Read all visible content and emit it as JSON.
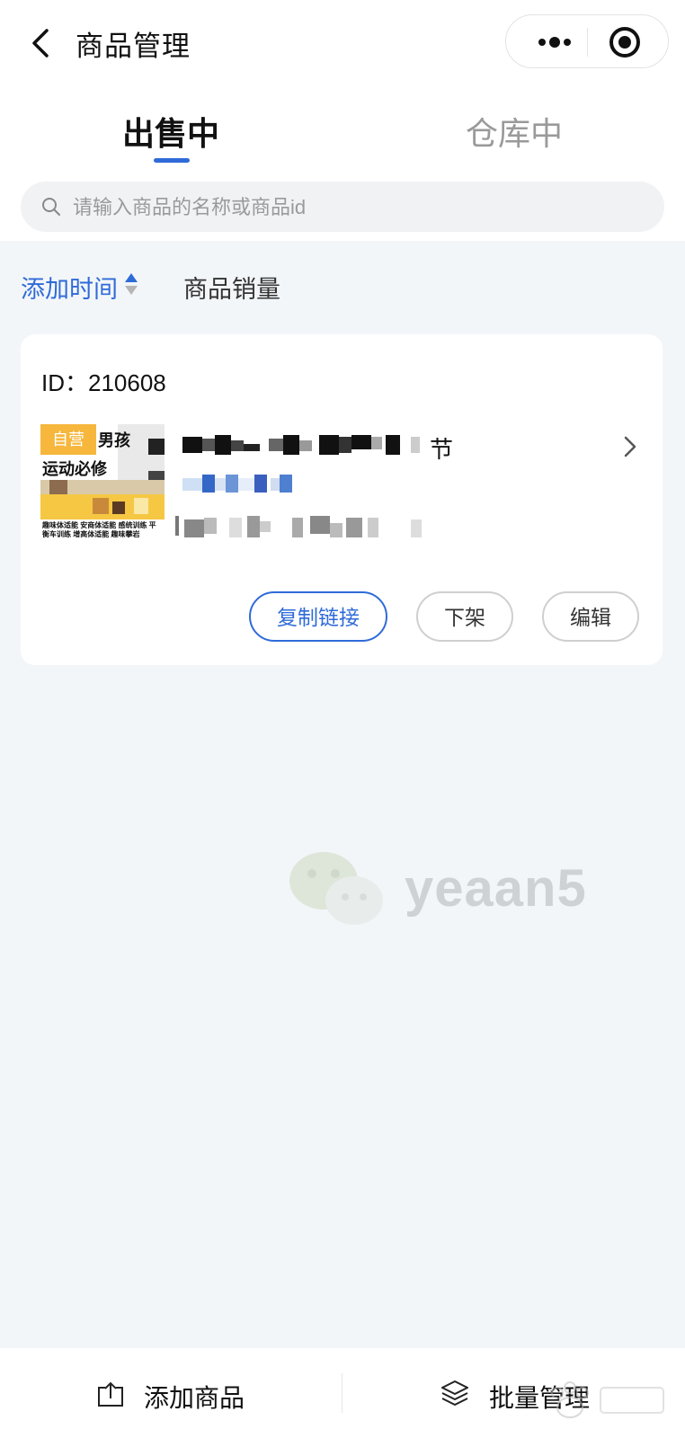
{
  "nav": {
    "title": "商品管理",
    "back_icon": "chevron-left-icon",
    "more_icon": "more-dots-icon",
    "close_icon": "target-close-icon"
  },
  "tabs": [
    {
      "label": "出售中",
      "active": true
    },
    {
      "label": "仓库中",
      "active": false
    }
  ],
  "search": {
    "placeholder": "请输入商品的名称或商品id",
    "value": ""
  },
  "sort": {
    "time_label": "添加时间",
    "sales_label": "商品销量"
  },
  "product": {
    "id_text": "ID：210608",
    "title_end": "节",
    "thumbnail": {
      "badge": "自营",
      "line1": "男孩",
      "line2": "运动必修",
      "footer": "趣味体适能 安商体适能 感统训练 平衡车训练 增高体适能 趣味攀岩"
    },
    "actions": {
      "copy_link": "复制链接",
      "delist": "下架",
      "edit": "编辑"
    }
  },
  "watermark": {
    "text": "yeaan5"
  },
  "bottom_bar": {
    "add_label": "添加商品",
    "batch_label": "批量管理"
  },
  "colors": {
    "accent": "#2f6bd8",
    "background": "#f3f6f9",
    "badge": "#f6b73c"
  }
}
